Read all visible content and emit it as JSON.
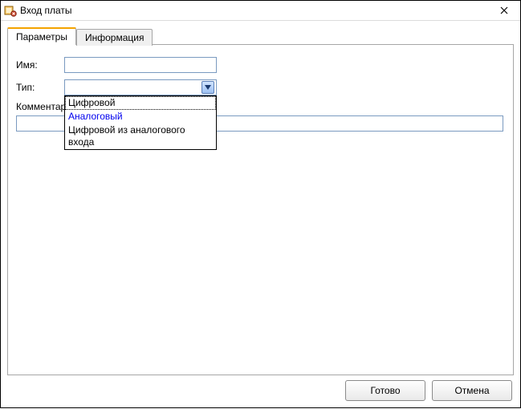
{
  "window": {
    "title": "Вход платы"
  },
  "tabs": {
    "t0": "Параметры",
    "t1": "Информация"
  },
  "form": {
    "name_label": "Имя:",
    "name_value": "",
    "type_label": "Тип:",
    "type_value": "",
    "comment_label": "Комментарий:",
    "comment_value": ""
  },
  "type_options": {
    "o0": "Цифровой",
    "o1": "Аналоговый",
    "o2": "Цифровой из аналогового входа"
  },
  "buttons": {
    "ok": "Готово",
    "cancel": "Отмена"
  },
  "edge": {
    "c0": "а",
    "c1": "о",
    "c2": "ы",
    "c3": "ки",
    "c4": "р"
  }
}
